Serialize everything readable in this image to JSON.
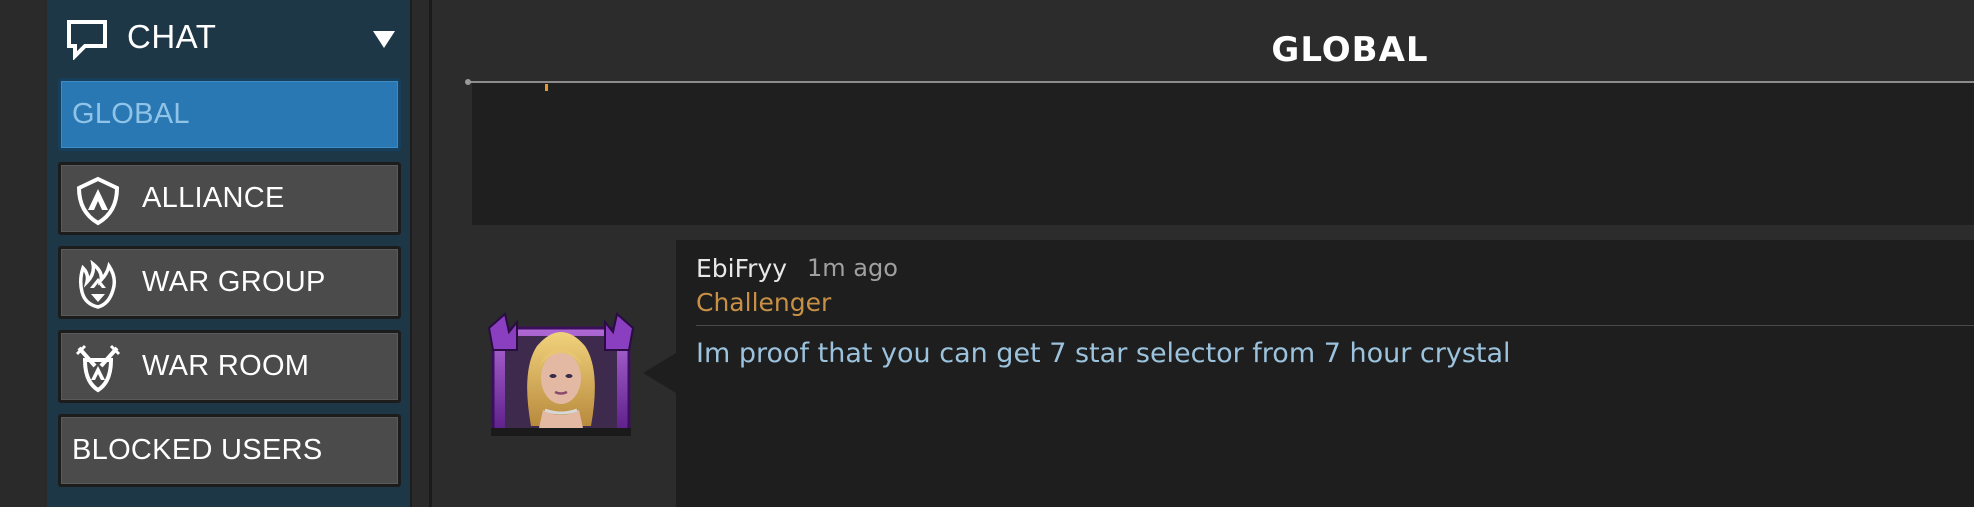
{
  "sidebar": {
    "header": {
      "label": "CHAT",
      "icon": "chat-bubble-icon"
    },
    "items": [
      {
        "label": "GLOBAL",
        "active": true,
        "icon": null
      },
      {
        "label": "ALLIANCE",
        "active": false,
        "icon": "alliance-shield-icon"
      },
      {
        "label": "WAR GROUP",
        "active": false,
        "icon": "war-group-flame-icon"
      },
      {
        "label": "WAR ROOM",
        "active": false,
        "icon": "war-room-swords-icon"
      },
      {
        "label": "BLOCKED USERS",
        "active": false,
        "icon": null
      }
    ]
  },
  "main": {
    "title": "GLOBAL",
    "message": {
      "username": "EbiFryy",
      "time": "1m ago",
      "rank": "Challenger",
      "text": "Im proof that you can get 7 star selector from 7 hour crystal",
      "avatar": "champion-portrait-avatar"
    }
  },
  "colors": {
    "sidebar_bg": "#1e3747",
    "active_button": "#2a78b3",
    "button_bg": "#4b4b4b",
    "rank_color": "#c89045",
    "message_text": "#9cc3dd"
  }
}
